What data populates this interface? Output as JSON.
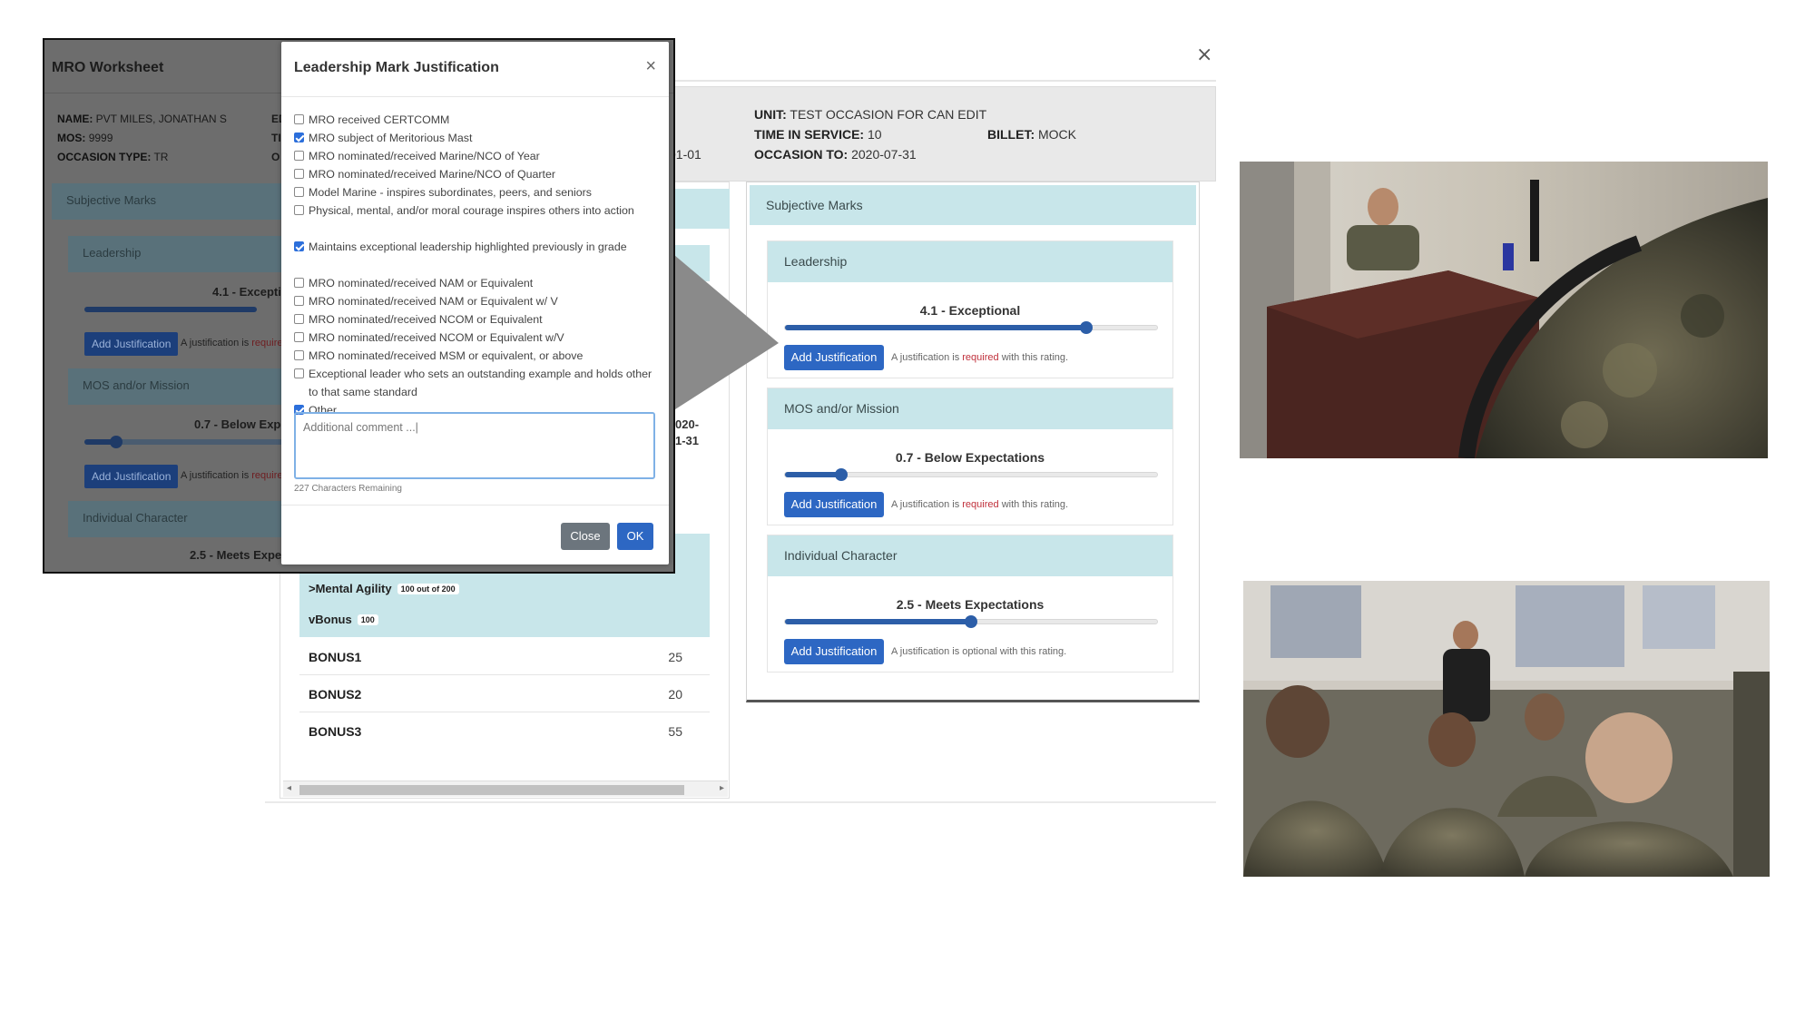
{
  "background": {
    "close_symbol": "×",
    "info": {
      "unit_label": "UNIT:",
      "unit_value": "TEST OCCASION FOR CAN EDIT",
      "tis_label": "TIME IN SERVICE:",
      "tis_value": "10",
      "billet_label": "BILLET:",
      "billet_value": "MOCK",
      "occ_to_label": "OCCASION TO:",
      "occ_to_value": "2020-07-31",
      "partial_from": "01-01",
      "partial_date_a": "020-",
      "partial_date_b": "1-31"
    },
    "left_list": {
      "mental_agility": {
        "label": "Mental Agility",
        "badge": "100 out of 200",
        "chevron": ">"
      },
      "bonus": {
        "label": "Bonus",
        "badge": "100",
        "chevron": "v"
      },
      "rows": [
        {
          "name": "BONUS1",
          "value": "25"
        },
        {
          "name": "BONUS2",
          "value": "20"
        },
        {
          "name": "BONUS3",
          "value": "55"
        }
      ]
    },
    "subjective": {
      "header": "Subjective Marks",
      "sections": [
        {
          "title": "Leadership",
          "rating_label": "4.1 - Exceptional",
          "level_fraction": 0.81,
          "button": "Add Justification",
          "note_pre": "A justification is",
          "note_req": "required",
          "note_post": "with this rating.",
          "required": true
        },
        {
          "title": "MOS and/or Mission",
          "rating_label": "0.7 - Below Expectations",
          "level_fraction": 0.15,
          "button": "Add Justification",
          "note_pre": "A justification is",
          "note_req": "required",
          "note_post": "with this rating.",
          "required": true
        },
        {
          "title": "Individual Character",
          "rating_label": "2.5 - Meets Expectations",
          "level_fraction": 0.5,
          "button": "Add Justification",
          "note_pre": "A justification is optional with this rating.",
          "note_req": "",
          "note_post": "",
          "required": false
        }
      ]
    }
  },
  "overlay": {
    "title": "MRO Worksheet",
    "info": {
      "name_label": "NAME:",
      "name_value": "PVT MILES, JONATHAN S",
      "mos_label": "MOS:",
      "mos_value": "9999",
      "occ_type_label": "OCCASION TYPE:",
      "occ_type_value": "TR",
      "cut_a": "ED",
      "cut_b": "TI",
      "cut_c": "O"
    },
    "subjective_header": "Subjective Marks",
    "leadership": "Leadership",
    "leadership_value": "4.1 - Exceptio",
    "leadership_level": 0.81,
    "mos": "MOS and/or Mission",
    "mos_value": "0.7 - Below Expe",
    "mos_level": 0.15,
    "individual": "Individual Character",
    "individual_value": "2.5 - Meets Expectations",
    "btn": "Add Justification",
    "note": "A justification is",
    "note_req": "require"
  },
  "modal": {
    "title": "Leadership Mark Justification",
    "close_symbol": "×",
    "options": [
      {
        "label": "MRO received CERTCOMM",
        "checked": false
      },
      {
        "label": "MRO subject of Meritorious Mast",
        "checked": true
      },
      {
        "label": "MRO nominated/received Marine/NCO of Year",
        "checked": false
      },
      {
        "label": "MRO nominated/received Marine/NCO of Quarter",
        "checked": false
      },
      {
        "label": "Model Marine - inspires subordinates, peers, and seniors",
        "checked": false
      },
      {
        "label": "Physical, mental, and/or moral courage inspires others into action",
        "checked": false
      },
      {
        "label": "Maintains exceptional leadership highlighted previously in grade",
        "checked": true
      },
      {
        "label": "MRO nominated/received NAM or Equivalent",
        "checked": false
      },
      {
        "label": "MRO nominated/received NAM or Equivalent w/ V",
        "checked": false
      },
      {
        "label": "MRO nominated/received NCOM or Equivalent",
        "checked": false
      },
      {
        "label": "MRO nominated/received NCOM or Equivalent w/V",
        "checked": false
      },
      {
        "label": "MRO nominated/received MSM or equivalent, or above",
        "checked": false
      },
      {
        "label": "Exceptional leader who sets an outstanding example and holds other to that same standard",
        "checked": false
      },
      {
        "label": "Other",
        "checked": true
      }
    ],
    "comment_placeholder": "Additional comment ...|",
    "chars_remaining": "227 Characters Remaining",
    "close_button": "Close",
    "ok_button": "OK"
  },
  "colors": {
    "primary": "#2d67c3",
    "teal_header": "#c8e6ea",
    "required_red": "#c0303b"
  }
}
